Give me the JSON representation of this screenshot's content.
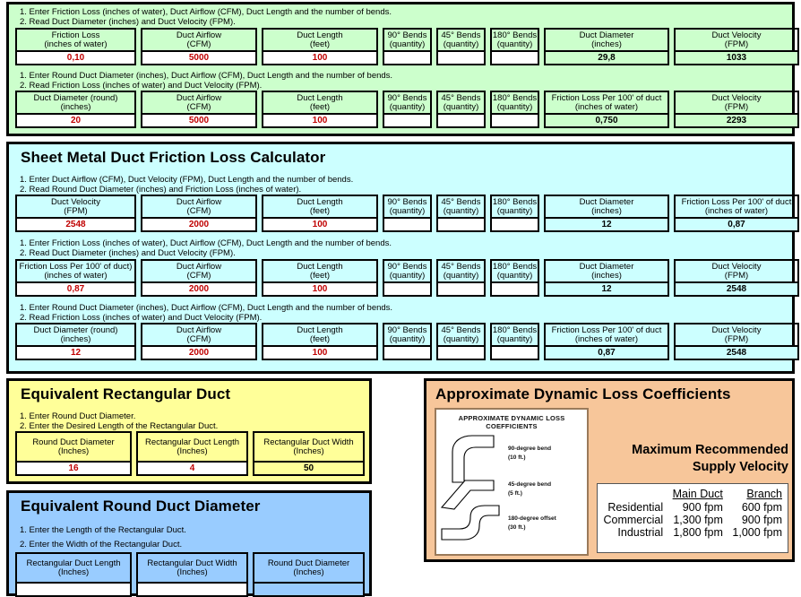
{
  "panels": {
    "green": {
      "rows": [
        {
          "instructions": [
            "1. Enter Friction Loss (inches of water), Duct Airflow (CFM), Duct Length  and the number of bends.",
            "2. Read Duct Diameter (inches) and Duct Velocity (FPM)."
          ],
          "fields": [
            {
              "label1": "Friction Loss",
              "label2": "(inches of water)",
              "value": "0,10",
              "kind": "input"
            },
            {
              "label1": "Duct Airflow",
              "label2": "(CFM)",
              "value": "5000",
              "kind": "input"
            },
            {
              "label1": "Duct Length",
              "label2": "(feet)",
              "value": "100",
              "kind": "input"
            },
            {
              "label1": "90° Bends",
              "label2": "(quantity)",
              "value": "",
              "kind": "input"
            },
            {
              "label1": "45° Bends",
              "label2": "(quantity)",
              "value": "",
              "kind": "input"
            },
            {
              "label1": "180° Bends",
              "label2": "(quantity)",
              "value": "",
              "kind": "input"
            },
            {
              "label1": "Duct Diameter",
              "label2": "(inches)",
              "value": "29,8",
              "kind": "output"
            },
            {
              "label1": "Duct Velocity",
              "label2": "(FPM)",
              "value": "1033",
              "kind": "output"
            }
          ]
        },
        {
          "instructions": [
            "1. Enter Round Duct Diameter (inches), Duct Airflow (CFM), Duct Length and the number of bends.",
            "2. Read Friction Loss (inches of water) and Duct Velocity (FPM)."
          ],
          "fields": [
            {
              "label1": "Duct Diameter (round)",
              "label2": "(inches)",
              "value": "20",
              "kind": "input"
            },
            {
              "label1": "Duct Airflow",
              "label2": "(CFM)",
              "value": "5000",
              "kind": "input"
            },
            {
              "label1": "Duct Length",
              "label2": "(feet)",
              "value": "100",
              "kind": "input"
            },
            {
              "label1": "90° Bends",
              "label2": "(quantity)",
              "value": "",
              "kind": "input"
            },
            {
              "label1": "45° Bends",
              "label2": "(quantity)",
              "value": "",
              "kind": "input"
            },
            {
              "label1": "180° Bends",
              "label2": "(quantity)",
              "value": "",
              "kind": "input"
            },
            {
              "label1": "Friction Loss Per 100' of duct",
              "label2": "(inches of water)",
              "value": "0,750",
              "kind": "output"
            },
            {
              "label1": "Duct Velocity",
              "label2": "(FPM)",
              "value": "2293",
              "kind": "output"
            }
          ]
        }
      ]
    },
    "cyan": {
      "title": "Sheet Metal Duct Friction Loss Calculator",
      "rows": [
        {
          "instructions": [
            "1. Enter Duct Airflow (CFM), Duct Velocity (FPM), Duct Length and the number of bends.",
            "2. Read Round Duct Diameter (inches) and Friction Loss (inches of water)."
          ],
          "fields": [
            {
              "label1": "Duct Velocity",
              "label2": "(FPM)",
              "value": "2548",
              "kind": "input"
            },
            {
              "label1": "Duct Airflow",
              "label2": "(CFM)",
              "value": "2000",
              "kind": "input"
            },
            {
              "label1": "Duct Length",
              "label2": "(feet)",
              "value": "100",
              "kind": "input"
            },
            {
              "label1": "90° Bends",
              "label2": "(quantity)",
              "value": "",
              "kind": "input"
            },
            {
              "label1": "45° Bends",
              "label2": "(quantity)",
              "value": "",
              "kind": "input"
            },
            {
              "label1": "180° Bends",
              "label2": "(quantity)",
              "value": "",
              "kind": "input"
            },
            {
              "label1": "Duct Diameter",
              "label2": "(inches)",
              "value": "12",
              "kind": "output"
            },
            {
              "label1": "Friction Loss Per 100' of duct",
              "label2": "(inches of water)",
              "value": "0,87",
              "kind": "output"
            }
          ]
        },
        {
          "instructions": [
            "1. Enter Friction Loss (inches of water), Duct Airflow (CFM), Duct Length  and the number of bends.",
            "2. Read Duct Diameter (inches) and Duct Velocity (FPM)."
          ],
          "fields": [
            {
              "label1": "Friction Loss Per 100' of duct)",
              "label2": "(inches of water)",
              "value": "0,87",
              "kind": "input"
            },
            {
              "label1": "Duct Airflow",
              "label2": "(CFM)",
              "value": "2000",
              "kind": "input"
            },
            {
              "label1": "Duct Length",
              "label2": "(feet)",
              "value": "100",
              "kind": "input"
            },
            {
              "label1": "90° Bends",
              "label2": "(quantity)",
              "value": "",
              "kind": "input"
            },
            {
              "label1": "45° Bends",
              "label2": "(quantity)",
              "value": "",
              "kind": "input"
            },
            {
              "label1": "180° Bends",
              "label2": "(quantity)",
              "value": "",
              "kind": "input"
            },
            {
              "label1": "Duct Diameter",
              "label2": "(inches)",
              "value": "12",
              "kind": "output"
            },
            {
              "label1": "Duct Velocity",
              "label2": "(FPM)",
              "value": "2548",
              "kind": "output"
            }
          ]
        },
        {
          "instructions": [
            "1. Enter Round Duct Diameter (inches), Duct Airflow (CFM), Duct Length and the number of bends.",
            "2. Read Friction Loss (inches of water) and Duct Velocity (FPM)."
          ],
          "fields": [
            {
              "label1": "Duct Diameter (round)",
              "label2": "(inches)",
              "value": "12",
              "kind": "input"
            },
            {
              "label1": "Duct Airflow",
              "label2": "(CFM)",
              "value": "2000",
              "kind": "input"
            },
            {
              "label1": "Duct Length",
              "label2": "(feet)",
              "value": "100",
              "kind": "input"
            },
            {
              "label1": "90° Bends",
              "label2": "(quantity)",
              "value": "",
              "kind": "input"
            },
            {
              "label1": "45° Bends",
              "label2": "(quantity)",
              "value": "",
              "kind": "input"
            },
            {
              "label1": "180° Bends",
              "label2": "(quantity)",
              "value": "",
              "kind": "input"
            },
            {
              "label1": "Friction Loss Per 100' of duct",
              "label2": "(inches of water)",
              "value": "0,87",
              "kind": "output"
            },
            {
              "label1": "Duct Velocity",
              "label2": "(FPM)",
              "value": "2548",
              "kind": "output"
            }
          ]
        }
      ]
    },
    "yellow": {
      "title": "Equivalent Rectangular Duct",
      "instructions": [
        "1. Enter Round Duct Diameter.",
        "2. Enter the Desired Length of the Rectangular Duct."
      ],
      "fields": [
        {
          "label1": "Round Duct Diameter",
          "label2": "(Inches)",
          "value": "16",
          "kind": "input"
        },
        {
          "label1": "Rectangular Duct Length",
          "label2": "(Inches)",
          "value": "4",
          "kind": "input"
        },
        {
          "label1": "Rectangular Duct Width",
          "label2": "(Inches)",
          "value": "50",
          "kind": "output"
        }
      ]
    },
    "blue": {
      "title": "Equivalent Round Duct Diameter",
      "instructions": [
        "1. Enter the Length of the Rectangular Duct.",
        "2. Enter the Width of the Rectangular Duct."
      ],
      "fields": [
        {
          "label1": "Rectangular Duct Length",
          "label2": "(Inches)",
          "value": "",
          "kind": "input"
        },
        {
          "label1": "Rectangular Duct Width",
          "label2": "(Inches)",
          "value": "",
          "kind": "input"
        },
        {
          "label1": "Round Duct Diameter",
          "label2": "(Inches)",
          "value": "",
          "kind": "output"
        }
      ]
    },
    "orange": {
      "title": "Approximate Dynamic Loss Coefficients",
      "diagram": {
        "title_line1": "APPROXIMATE DYNAMIC LOSS",
        "title_line2": "COEFFICIENTS",
        "items": [
          {
            "name": "90-degree bend",
            "detail": "(10 ft.)"
          },
          {
            "name": "45-degree bend",
            "detail": "(5 ft.)"
          },
          {
            "name": "180-degree offset",
            "detail": "(30 ft.)"
          }
        ]
      },
      "max_rec": {
        "line1": "Maximum Recommended",
        "line2": "Supply Velocity"
      },
      "velocity_table": {
        "columns": [
          "",
          "Main Duct",
          "Branch"
        ],
        "rows": [
          {
            "label": "Residential",
            "main": "900 fpm",
            "branch": "600 fpm"
          },
          {
            "label": "Commercial",
            "main": "1,300 fpm",
            "branch": "900 fpm"
          },
          {
            "label": "Industrial",
            "main": "1,800 fpm",
            "branch": "1,000 fpm"
          }
        ]
      }
    }
  },
  "colors": {
    "green": "#ccffcc",
    "cyan": "#ccffff",
    "yellow": "#ffff99",
    "blue": "#99ccff",
    "orange": "#f7c69a",
    "input_text": "#c00000",
    "output_text": "#000000"
  }
}
